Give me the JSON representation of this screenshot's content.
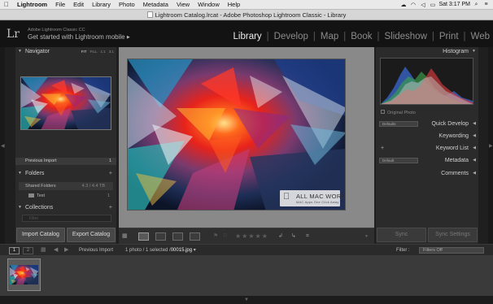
{
  "menubar": {
    "items": [
      "Lightroom",
      "File",
      "Edit",
      "Library",
      "Photo",
      "Metadata",
      "View",
      "Window",
      "Help"
    ],
    "clock": "Sat 3:17 PM"
  },
  "window": {
    "title": "Lightroom Catalog.lrcat - Adobe Photoshop Lightroom Classic - Library"
  },
  "identity": {
    "logo": "Lr",
    "subtitle": "Adobe Lightroom Classic CC",
    "tagline": "Get started with Lightroom mobile",
    "tagline_arrow": "▶"
  },
  "modules": [
    {
      "label": "Library",
      "active": true
    },
    {
      "label": "Develop",
      "active": false
    },
    {
      "label": "Map",
      "active": false
    },
    {
      "label": "Book",
      "active": false
    },
    {
      "label": "Slideshow",
      "active": false
    },
    {
      "label": "Print",
      "active": false
    },
    {
      "label": "Web",
      "active": false
    }
  ],
  "left_panel": {
    "navigator": {
      "title": "Navigator",
      "options": [
        "FIT",
        "FILL",
        "1:1",
        "3:1"
      ]
    },
    "previous_import": {
      "label": "Previous Import",
      "count": "1"
    },
    "folders": {
      "title": "Folders",
      "volume": {
        "label": "Shared Folders",
        "info": "4.3 / 4.4 TB"
      },
      "folder": {
        "label": "Test",
        "count": "1"
      }
    },
    "collections": {
      "title": "Collections",
      "filter_placeholder": "Filter"
    },
    "import_button": "Import Catalog",
    "export_button": "Export Catalog"
  },
  "right_panel": {
    "histogram_title": "Histogram",
    "original_photo": "Original Photo",
    "quick_develop": {
      "label": "Quick Develop",
      "preset": "Defaults"
    },
    "keywording": "Keywording",
    "keyword_list": "Keyword List",
    "metadata": {
      "label": "Metadata",
      "preset": "Default"
    },
    "comments": "Comments",
    "sync_button": "Sync",
    "sync_settings_button": "Sync Settings"
  },
  "watermark": {
    "title": "ALL MAC WORLD",
    "subtitle": "MAC Apps One Click Away"
  },
  "filmstrip_bar": {
    "page1": "1",
    "page2": "2",
    "source": "Previous Import",
    "selection_prefix": "1 photo / 1 selected /",
    "filename": "00015.jpg",
    "dropdown_arrow": "▾",
    "filter_label": "Filter :",
    "filter_value": "Filters Off"
  },
  "colors": {
    "accent": "#e8e8e8",
    "panel": "#2b2b2b",
    "center_bg": "#898989",
    "identity_bg": "#131313"
  },
  "icons": [
    "apple-icon",
    "chevron-left-icon",
    "chevron-right-icon",
    "grid-view-icon",
    "loupe-view-icon",
    "compare-view-icon",
    "survey-view-icon",
    "people-view-icon",
    "flag-icon",
    "rotate-icon",
    "search-icon",
    "wifi-icon",
    "spotlight-icon",
    "list-icon"
  ]
}
